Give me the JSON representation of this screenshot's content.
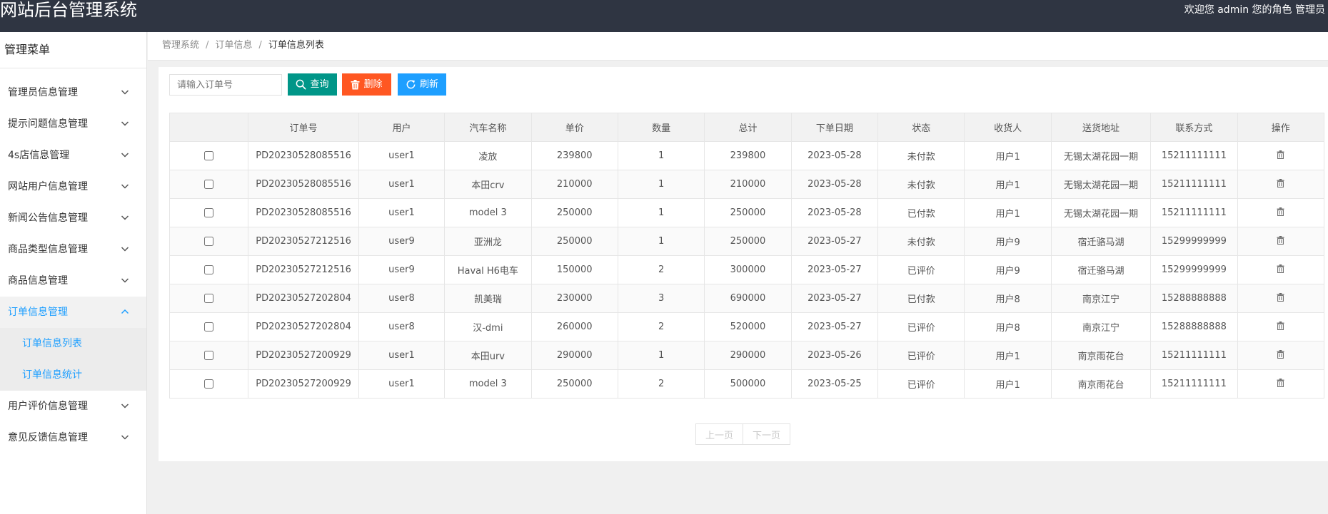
{
  "header": {
    "app_title": "网站后台管理系统",
    "welcome": "欢迎您 admin 您的角色 管理员"
  },
  "sidebar": {
    "title": "管理菜单",
    "items": [
      {
        "label": "管理员信息管理"
      },
      {
        "label": "提示问题信息管理"
      },
      {
        "label": "4s店信息管理"
      },
      {
        "label": "网站用户信息管理"
      },
      {
        "label": "新闻公告信息管理"
      },
      {
        "label": "商品类型信息管理"
      },
      {
        "label": "商品信息管理"
      },
      {
        "label": "订单信息管理",
        "expanded": true,
        "children": [
          {
            "label": "订单信息列表"
          },
          {
            "label": "订单信息统计"
          }
        ]
      },
      {
        "label": "用户评价信息管理"
      },
      {
        "label": "意见反馈信息管理"
      }
    ]
  },
  "breadcrumb": [
    "管理系统",
    "订单信息",
    "订单信息列表"
  ],
  "toolbar": {
    "search_placeholder": "请输入订单号",
    "search_value": "",
    "query_label": "查询",
    "delete_label": "删除",
    "refresh_label": "刷新"
  },
  "table": {
    "columns": [
      "",
      "订单号",
      "用户",
      "汽车名称",
      "单价",
      "数量",
      "总计",
      "下单日期",
      "状态",
      "收货人",
      "送货地址",
      "联系方式",
      "操作"
    ],
    "rows": [
      [
        "PD20230528085516",
        "user1",
        "凌放",
        "239800",
        "1",
        "239800",
        "2023-05-28",
        "未付款",
        "用户1",
        "无锡太湖花园一期",
        "15211111111"
      ],
      [
        "PD20230528085516",
        "user1",
        "本田crv",
        "210000",
        "1",
        "210000",
        "2023-05-28",
        "未付款",
        "用户1",
        "无锡太湖花园一期",
        "15211111111"
      ],
      [
        "PD20230528085516",
        "user1",
        "model 3",
        "250000",
        "1",
        "250000",
        "2023-05-28",
        "已付款",
        "用户1",
        "无锡太湖花园一期",
        "15211111111"
      ],
      [
        "PD20230527212516",
        "user9",
        "亚洲龙",
        "250000",
        "1",
        "250000",
        "2023-05-27",
        "未付款",
        "用户9",
        "宿迁骆马湖",
        "15299999999"
      ],
      [
        "PD20230527212516",
        "user9",
        "Haval H6电车",
        "150000",
        "2",
        "300000",
        "2023-05-27",
        "已评价",
        "用户9",
        "宿迁骆马湖",
        "15299999999"
      ],
      [
        "PD20230527202804",
        "user8",
        "凯美瑞",
        "230000",
        "3",
        "690000",
        "2023-05-27",
        "已付款",
        "用户8",
        "南京江宁",
        "15288888888"
      ],
      [
        "PD20230527202804",
        "user8",
        "汉-dmi",
        "260000",
        "2",
        "520000",
        "2023-05-27",
        "已评价",
        "用户8",
        "南京江宁",
        "15288888888"
      ],
      [
        "PD20230527200929",
        "user1",
        "本田urv",
        "290000",
        "1",
        "290000",
        "2023-05-26",
        "已评价",
        "用户1",
        "南京雨花台",
        "15211111111"
      ],
      [
        "PD20230527200929",
        "user1",
        "model 3",
        "250000",
        "2",
        "500000",
        "2023-05-25",
        "已评价",
        "用户1",
        "南京雨花台",
        "15211111111"
      ]
    ]
  },
  "pager": {
    "prev_label": "上一页",
    "next_label": "下一页"
  },
  "icons": {
    "chevron": "chevron-down-icon",
    "search": "search-icon",
    "delete": "trash-icon",
    "refresh": "refresh-icon",
    "row_action": "trash-icon"
  },
  "colors": {
    "header_bg": "#2f3542",
    "accent": "#1e9fff",
    "query_button": "#009688",
    "delete_button": "#ff5722",
    "refresh_button": "#1e9fff"
  }
}
